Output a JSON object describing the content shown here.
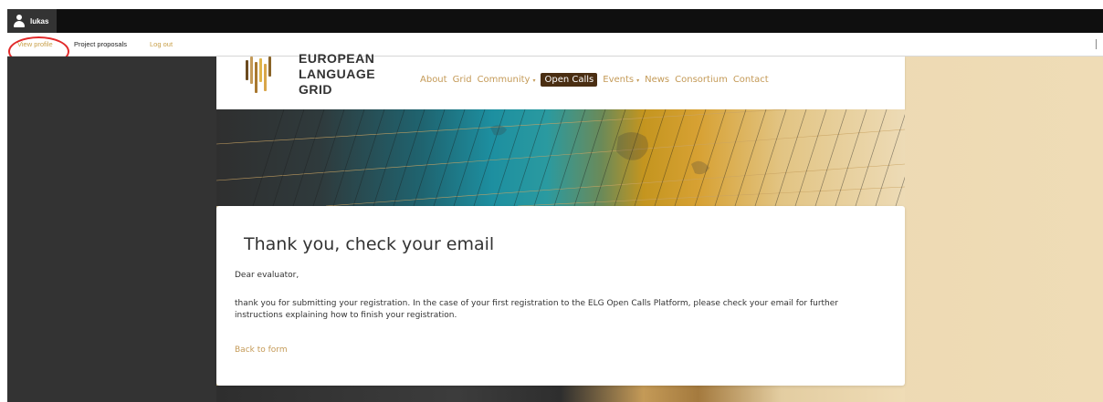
{
  "toolbar": {
    "user_name": "lukas",
    "view_profile": "View profile",
    "project_proposals": "Project proposals",
    "log_out": "Log out"
  },
  "logo": {
    "line1": "EUROPEAN",
    "line2": "LANGUAGE",
    "line3": "GRID"
  },
  "nav": {
    "about": "About",
    "grid": "Grid",
    "community": "Community",
    "open_calls": "Open Calls",
    "events": "Events",
    "news": "News",
    "consortium": "Consortium",
    "contact": "Contact",
    "caret": "▾"
  },
  "content": {
    "title": "Thank you, check your email",
    "greeting": "Dear evaluator,",
    "message": "thank you for submitting your registration. In the case of your first registration to the ELG Open Calls Platform, please check your email for further instructions explaining how to finish your registration.",
    "back_link": "Back to form"
  },
  "colors": {
    "accent": "#c49a57",
    "active_nav": "#4a2e12",
    "annotation": "#e22a2a"
  },
  "icons": {
    "user": "user-icon",
    "collapse": "toolbar-collapse-icon"
  }
}
